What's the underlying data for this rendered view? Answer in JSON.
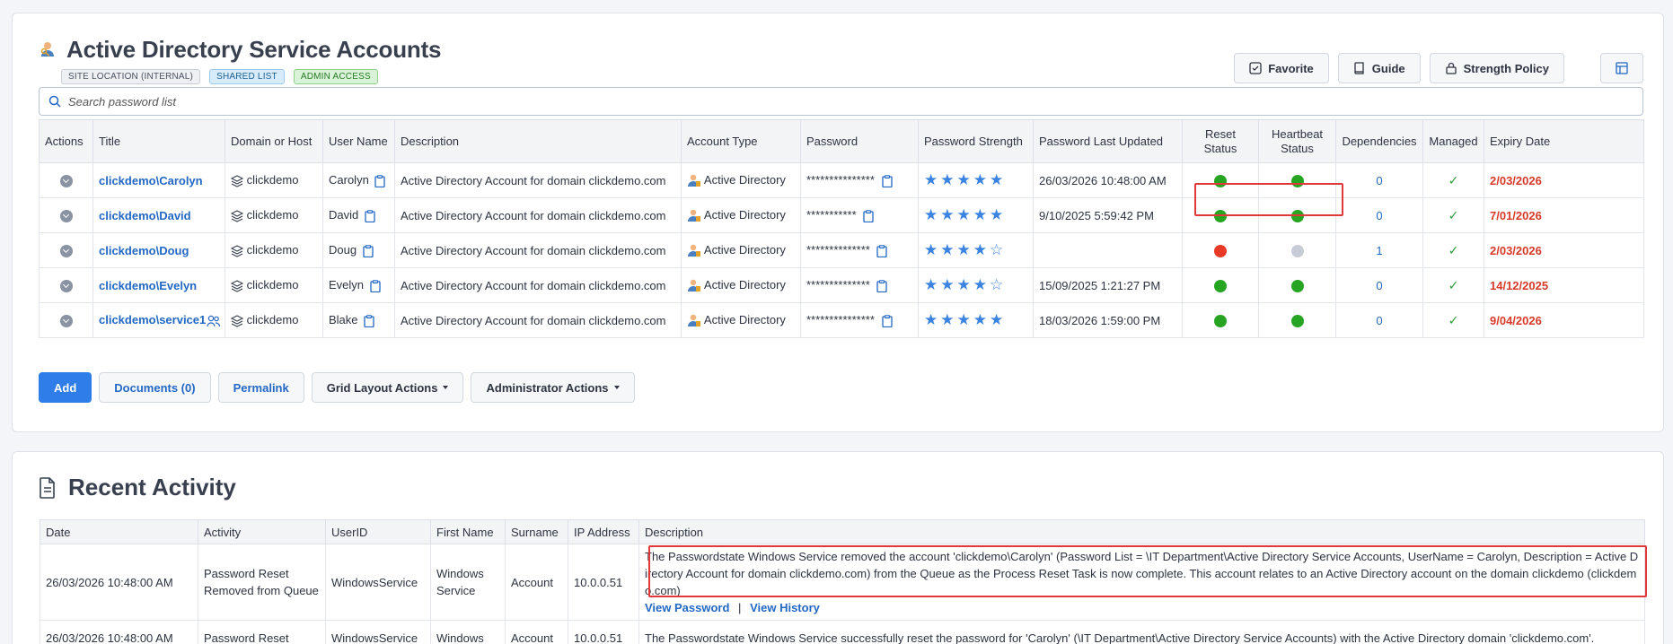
{
  "header": {
    "title": "Active Directory Service Accounts",
    "badges": [
      "SITE LOCATION (INTERNAL)",
      "SHARED LIST",
      "ADMIN ACCESS"
    ],
    "buttons": {
      "favorite": "Favorite",
      "guide": "Guide",
      "strength_policy": "Strength Policy"
    },
    "icons": [
      "user-key-icon",
      "checkbox-icon",
      "book-icon",
      "lock-icon",
      "layout-icon"
    ]
  },
  "search": {
    "placeholder": "Search password list"
  },
  "grid": {
    "columns": {
      "actions": "Actions",
      "title": "Title",
      "domain": "Domain or Host",
      "username": "User Name",
      "description": "Description",
      "account_type": "Account Type",
      "password": "Password",
      "strength": "Password Strength",
      "last_updated": "Password Last Updated",
      "reset_status": "Reset Status",
      "heartbeat_status": "Heartbeat Status",
      "dependencies": "Dependencies",
      "managed": "Managed",
      "expiry": "Expiry Date"
    },
    "rows": [
      {
        "title": "clickdemo\\Carolyn",
        "domain": "clickdemo",
        "username": "Carolyn",
        "description": "Active Directory Account for domain clickdemo.com",
        "account_type": "Active Directory",
        "password": "***************",
        "stars": "★★★★★",
        "last_updated": "26/03/2026 10:48:00 AM",
        "reset": "#27a422",
        "heartbeat": "#27a422",
        "dependencies": "0",
        "managed": "✓",
        "expiry": "2/03/2026"
      },
      {
        "title": "clickdemo\\David",
        "domain": "clickdemo",
        "username": "David",
        "description": "Active Directory Account for domain clickdemo.com",
        "account_type": "Active Directory",
        "password": "***********",
        "stars": "★★★★★",
        "last_updated": "9/10/2025 5:59:42 PM",
        "reset": "#27a422",
        "heartbeat": "#27a422",
        "dependencies": "0",
        "managed": "✓",
        "expiry": "7/01/2026"
      },
      {
        "title": "clickdemo\\Doug",
        "domain": "clickdemo",
        "username": "Doug",
        "description": "Active Directory Account for domain clickdemo.com",
        "account_type": "Active Directory",
        "password": "**************",
        "stars": "★★★★☆",
        "last_updated": "",
        "reset": "#e83a26",
        "heartbeat": "#c8ccd6",
        "dependencies": "1",
        "managed": "✓",
        "expiry": "2/03/2026"
      },
      {
        "title": "clickdemo\\Evelyn",
        "domain": "clickdemo",
        "username": "Evelyn",
        "description": "Active Directory Account for domain clickdemo.com",
        "account_type": "Active Directory",
        "password": "**************",
        "stars": "★★★★☆",
        "last_updated": "15/09/2025 1:21:27 PM",
        "reset": "#27a422",
        "heartbeat": "#27a422",
        "dependencies": "0",
        "managed": "✓",
        "expiry": "14/12/2025"
      },
      {
        "title": "clickdemo\\service1",
        "domain": "clickdemo",
        "username": "Blake",
        "description": "Active Directory Account for domain clickdemo.com",
        "account_type": "Active Directory",
        "password": "***************",
        "stars": "★★★★★",
        "last_updated": "18/03/2026 1:59:00 PM",
        "reset": "#27a422",
        "heartbeat": "#27a422",
        "dependencies": "0",
        "managed": "✓",
        "expiry": "9/04/2026"
      }
    ]
  },
  "actions": {
    "add": "Add",
    "documents": "Documents (0)",
    "permalink": "Permalink",
    "grid_layout": "Grid Layout Actions",
    "admin": "Administrator Actions"
  },
  "recent": {
    "title": "Recent Activity",
    "columns": {
      "date": "Date",
      "activity": "Activity",
      "userid": "UserID",
      "first_name": "First Name",
      "surname": "Surname",
      "ip": "IP Address",
      "description": "Description"
    },
    "rows": [
      {
        "date": "26/03/2026 10:48:00 AM",
        "activity": "Password Reset Removed from Queue",
        "userid": "WindowsService",
        "first_name": "Windows Service",
        "surname": "Account",
        "ip": "10.0.0.51",
        "description": "The Passwordstate Windows Service removed the account 'clickdemo\\Carolyn' (Password List = \\IT Department\\Active Directory Service Accounts, UserName = Carolyn, Description = Active Directory Account for domain clickdemo.com) from the Queue as the Process Reset Task is now complete. This account relates to an Active Directory account on the domain clickdemo (clickdemo.com)",
        "view_password": "View Password",
        "separator": "|",
        "view_history": "View History"
      },
      {
        "date": "26/03/2026 10:48:00 AM",
        "activity": "Password Reset",
        "userid": "WindowsService",
        "first_name": "Windows",
        "surname": "Account",
        "ip": "10.0.0.51",
        "description": "The Passwordstate Windows Service successfully reset the password for 'Carolyn' (\\IT Department\\Active Directory Service Accounts) with the Active Directory domain 'clickdemo.com'."
      }
    ]
  }
}
